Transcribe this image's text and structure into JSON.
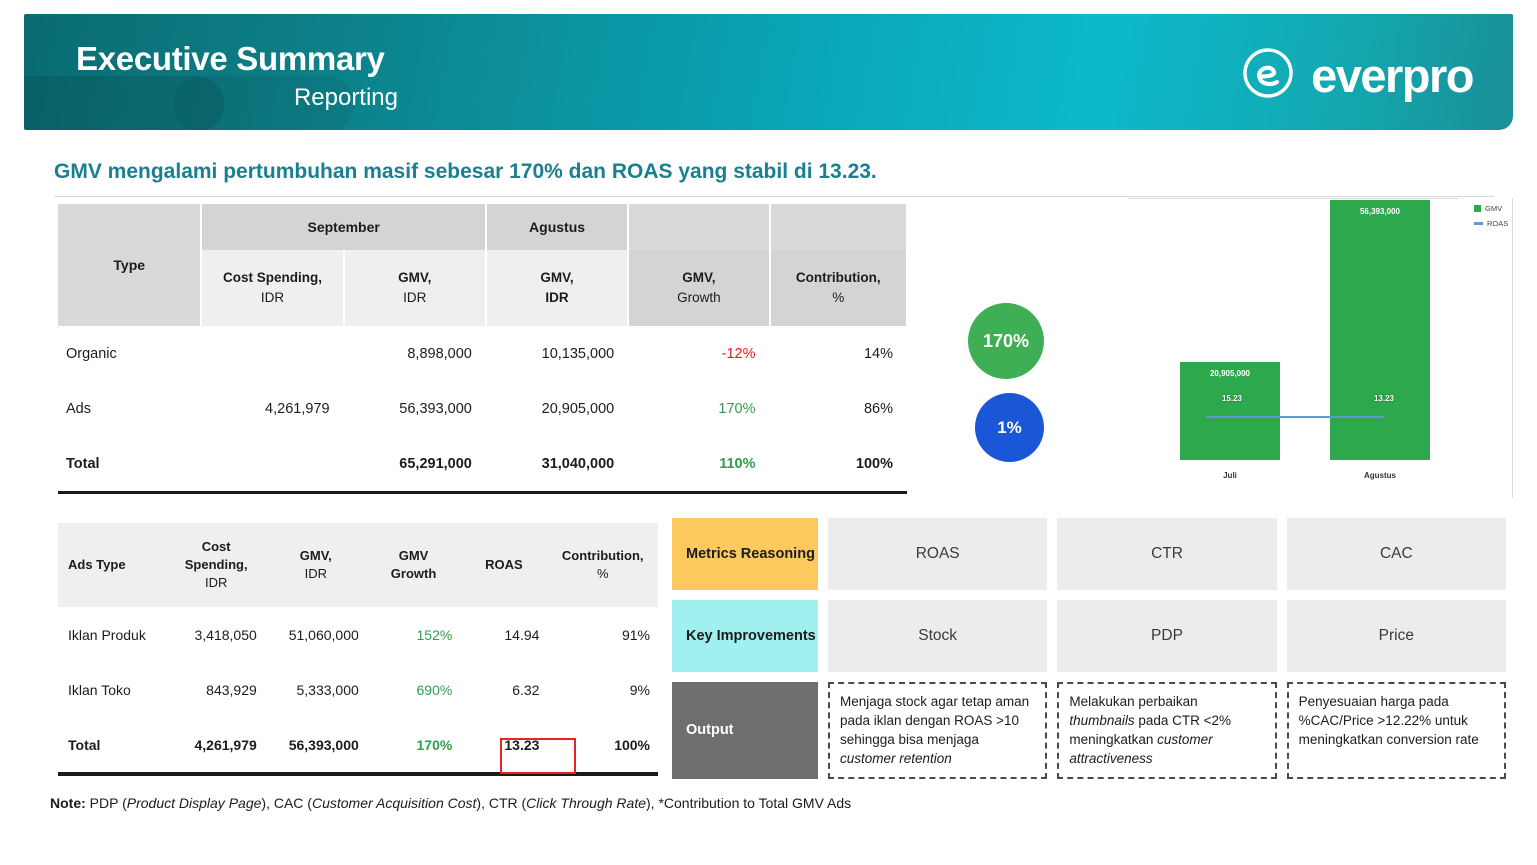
{
  "header": {
    "title": "Executive Summary",
    "subtitle": "Reporting",
    "logo_text": "everpro",
    "logo_icon": "everpro-circle-e-icon",
    "gradient_from": "#0a6b72",
    "gradient_to": "#0cb9cc"
  },
  "page_title": "GMV mengalami pertumbuhan masif sebesar 170% dan ROAS yang stabil di 13.23.",
  "title_color": "#1a7f91",
  "table_top": {
    "group_headers": [
      {
        "label": "",
        "span": 1
      },
      {
        "label": "September",
        "span": 2
      },
      {
        "label": "Agustus",
        "span": 1
      },
      {
        "label": "",
        "span": 1
      },
      {
        "label": "",
        "span": 1
      }
    ],
    "columns": [
      {
        "name": "Type",
        "unit": ""
      },
      {
        "name": "Cost Spending,",
        "unit": "IDR"
      },
      {
        "name": "GMV,",
        "unit": "IDR"
      },
      {
        "name": "GMV,",
        "unit": "IDR"
      },
      {
        "name": "GMV,",
        "unit": "Growth"
      },
      {
        "name": "Contribution,",
        "unit": "%"
      }
    ],
    "rows": [
      {
        "type": "Organic",
        "cost_spending": "",
        "gmv_sep": "8,898,000",
        "gmv_agu": "10,135,000",
        "gmv_growth": "-12%",
        "growth_sign": "negative",
        "contribution": "14%"
      },
      {
        "type": "Ads",
        "cost_spending": "4,261,979",
        "gmv_sep": "56,393,000",
        "gmv_agu": "20,905,000",
        "gmv_growth": "170%",
        "growth_sign": "positive",
        "contribution": "86%"
      },
      {
        "type": "Total",
        "cost_spending": "",
        "gmv_sep": "65,291,000",
        "gmv_agu": "31,040,000",
        "gmv_growth": "110%",
        "growth_sign": "positive",
        "contribution": "100%"
      }
    ]
  },
  "bubbles": [
    {
      "value": "170%",
      "color": "#3faf55",
      "name": "gmv-growth-bubble"
    },
    {
      "value": "1%",
      "color": "#1a57d6",
      "name": "secondary-metric-bubble"
    }
  ],
  "chart_data": {
    "type": "bar",
    "title": "",
    "categories": [
      "Juli",
      "Agustus"
    ],
    "series": [
      {
        "name": "GMV",
        "type": "bar",
        "color": "#2da84c",
        "values": [
          20905000,
          56393000
        ],
        "labels": [
          "20,905,000",
          "56,393,000"
        ]
      },
      {
        "name": "ROAS",
        "type": "line",
        "color": "#5b9bd5",
        "values": [
          15.23,
          13.23
        ],
        "labels": [
          "15.23",
          "13.23"
        ]
      }
    ],
    "legend": [
      "GMV",
      "ROAS"
    ],
    "legend_position": "right",
    "xlabel": "",
    "ylabel": "",
    "grid": false,
    "ylim": [
      0,
      60000000
    ]
  },
  "table_bottom": {
    "columns": [
      {
        "name": "Ads Type",
        "unit": ""
      },
      {
        "name": "Cost Spending,",
        "unit": "IDR"
      },
      {
        "name": "GMV,",
        "unit": "IDR"
      },
      {
        "name": "GMV",
        "unit": "Growth"
      },
      {
        "name": "ROAS",
        "unit": ""
      },
      {
        "name": "Contribution,",
        "unit": "%"
      }
    ],
    "rows": [
      {
        "ads_type": "Iklan Produk",
        "cost_spending": "3,418,050",
        "gmv": "51,060,000",
        "gmv_growth": "152%",
        "growth_sign": "positive",
        "roas": "14.94",
        "contribution": "91%"
      },
      {
        "ads_type": "Iklan Toko",
        "cost_spending": "843,929",
        "gmv": "5,333,000",
        "gmv_growth": "690%",
        "growth_sign": "positive",
        "roas": "6.32",
        "contribution": "9%"
      },
      {
        "ads_type": "Total",
        "cost_spending": "4,261,979",
        "gmv": "56,393,000",
        "gmv_growth": "170%",
        "growth_sign": "positive",
        "roas": "13.23",
        "contribution": "100%"
      }
    ],
    "highlight_color": "#ef2020",
    "highlight_cell": "total-roas"
  },
  "matrix": {
    "row_labels": [
      {
        "text": "Metrics Reasoning",
        "bg": "#fcc95f"
      },
      {
        "text": "Key Improvements",
        "bg": "#9ff0ef"
      },
      {
        "text": "Output",
        "bg": "#6e6e6e"
      }
    ],
    "metrics": [
      "ROAS",
      "CTR",
      "CAC"
    ],
    "improvements": [
      "Stock",
      "PDP",
      "Price"
    ],
    "outputs": [
      {
        "parts": [
          {
            "t": "Menjaga stock agar tetap aman pada iklan dengan ROAS >10 sehingga bisa menjaga ",
            "i": false
          },
          {
            "t": "customer retention",
            "i": true
          }
        ]
      },
      {
        "parts": [
          {
            "t": "Melakukan perbaikan ",
            "i": false
          },
          {
            "t": "thumbnails",
            "i": true
          },
          {
            "t": " pada CTR <2% meningkatkan ",
            "i": false
          },
          {
            "t": "customer attractiveness",
            "i": true
          }
        ]
      },
      {
        "parts": [
          {
            "t": "Penyesuaian harga pada %CAC/Price >12.22% untuk meningkatkan conversion rate",
            "i": false
          }
        ]
      }
    ]
  },
  "note": {
    "label": "Note:",
    "parts": [
      {
        "t": " PDP (",
        "i": false
      },
      {
        "t": "Product Display Page",
        "i": true
      },
      {
        "t": "), CAC (",
        "i": false
      },
      {
        "t": "Customer Acquisition Cost",
        "i": true
      },
      {
        "t": "), CTR (",
        "i": false
      },
      {
        "t": "Click Through Rate",
        "i": true
      },
      {
        "t": "), *Contribution to  Total GMV Ads",
        "i": false
      }
    ]
  }
}
